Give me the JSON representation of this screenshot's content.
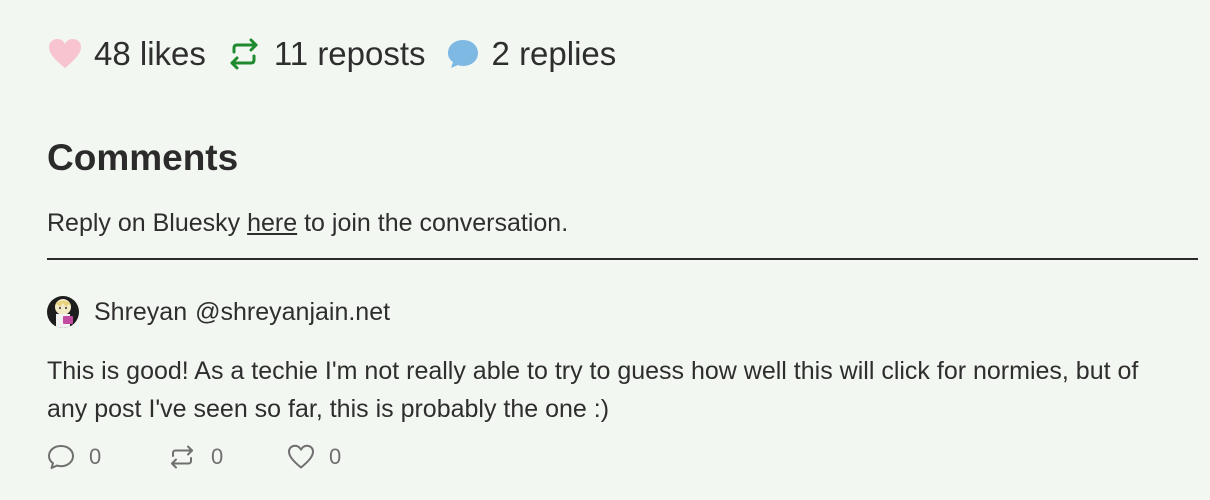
{
  "post_stats": {
    "likes": "48 likes",
    "reposts": "11 reposts",
    "replies": "2 replies",
    "colors": {
      "heart": "#f8c4cf",
      "repost": "#1f8a2e",
      "reply_bubble": "#7db9e3"
    }
  },
  "comments_section": {
    "heading": "Comments",
    "reply_prefix": "Reply on Bluesky ",
    "reply_link": "here",
    "reply_suffix": " to join the conversation."
  },
  "comments": [
    {
      "author": "Shreyan",
      "handle": "@shreyanjain.net",
      "text": "This is good! As a techie I'm not really able to try to guess how well this will click for normies, but of any post I've seen so far, this is probably the one :)",
      "reply_count": "0",
      "repost_count": "0",
      "like_count": "0"
    }
  ]
}
